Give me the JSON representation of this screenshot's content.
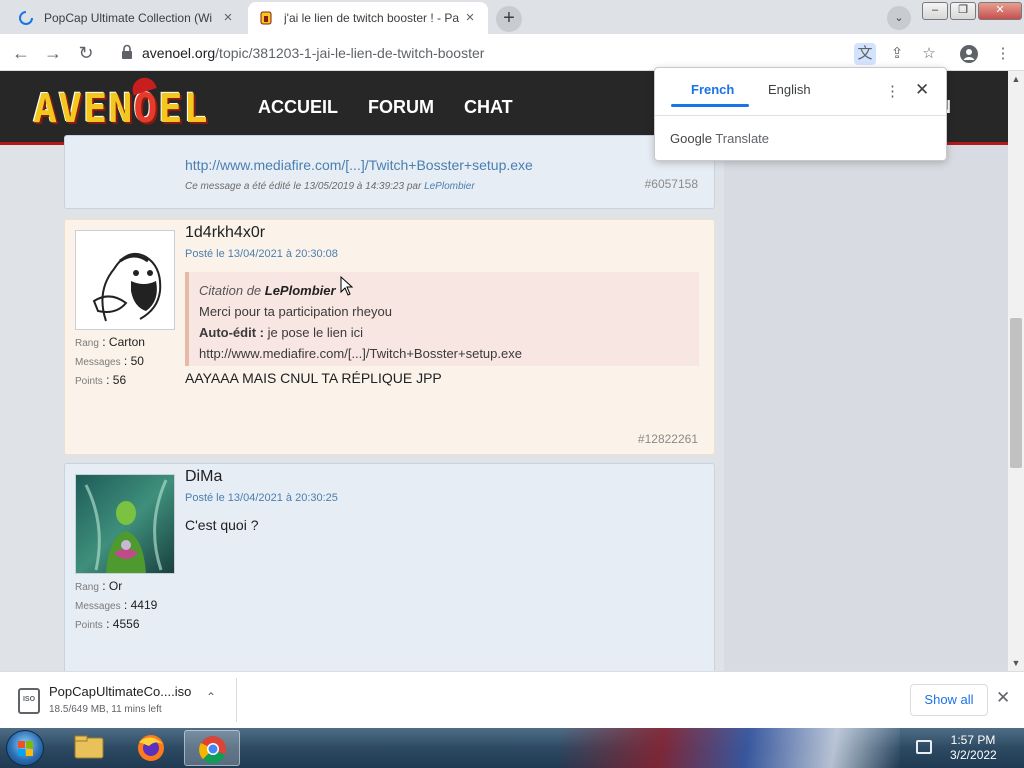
{
  "browser": {
    "tabs": [
      {
        "title": "PopCap Ultimate Collection (Wi",
        "active": false
      },
      {
        "title": "j'ai le lien de twitch booster ! - Pa",
        "active": true
      }
    ],
    "url_domain": "avenoel.org",
    "url_path": "/topic/381203-1-jai-le-lien-de-twitch-booster",
    "new_tab": "+",
    "close_glyph": "×"
  },
  "site": {
    "logo_text_a": "AVEN",
    "logo_text_b": "O",
    "logo_text_c": "EL",
    "nav": [
      "ACCUEIL",
      "FORUM",
      "CHAT"
    ],
    "nav_right_partial": "N"
  },
  "translate_popup": {
    "tab_source": "French",
    "tab_target": "English",
    "brand_google": "Google",
    "brand_translate": "Translate",
    "more": "⋮",
    "close": "✕"
  },
  "posts": [
    {
      "link_text": "http://www.mediafire.com/[...]/Twitch+Bosster+setup.exe",
      "edit_note_prefix": "Ce message a été édité le 13/05/2019 à 14:39:23 par ",
      "edit_note_user": "LePlombier",
      "number": "#6057158"
    },
    {
      "author": "1d4rkh4x0r",
      "date": "Posté le 13/04/2021 à 20:30:08",
      "stats": [
        {
          "key": "Rang",
          "value": ": Carton"
        },
        {
          "key": "Messages",
          "value": ": 50"
        },
        {
          "key": "Points",
          "value": ": 56"
        }
      ],
      "quote": {
        "head_prefix": "Citation de ",
        "head_user": "LePlombier",
        "line1": "Merci pour ta participation rheyou",
        "line2_label": "Auto-édit :",
        "line2_text": " je pose le lien ici",
        "line3": "http://www.mediafire.com/[...]/Twitch+Bosster+setup.exe"
      },
      "message": "AAYAAA MAIS CNUL TA RÉPLIQUE JPP",
      "number": "#12822261"
    },
    {
      "author": "DiMa",
      "date": "Posté le 13/04/2021 à 20:30:25",
      "stats": [
        {
          "key": "Rang",
          "value": ": Or"
        },
        {
          "key": "Messages",
          "value": ": 4419"
        },
        {
          "key": "Points",
          "value": ": 4556"
        }
      ],
      "message": "C'est quoi ?"
    }
  ],
  "download": {
    "filename": "PopCapUltimateCo....iso",
    "status": "18.5/649 MB, 11 mins left",
    "show_all": "Show all",
    "file_badge": "ISO"
  },
  "taskbar": {
    "time": "1:57 PM",
    "date": "3/2/2022"
  }
}
